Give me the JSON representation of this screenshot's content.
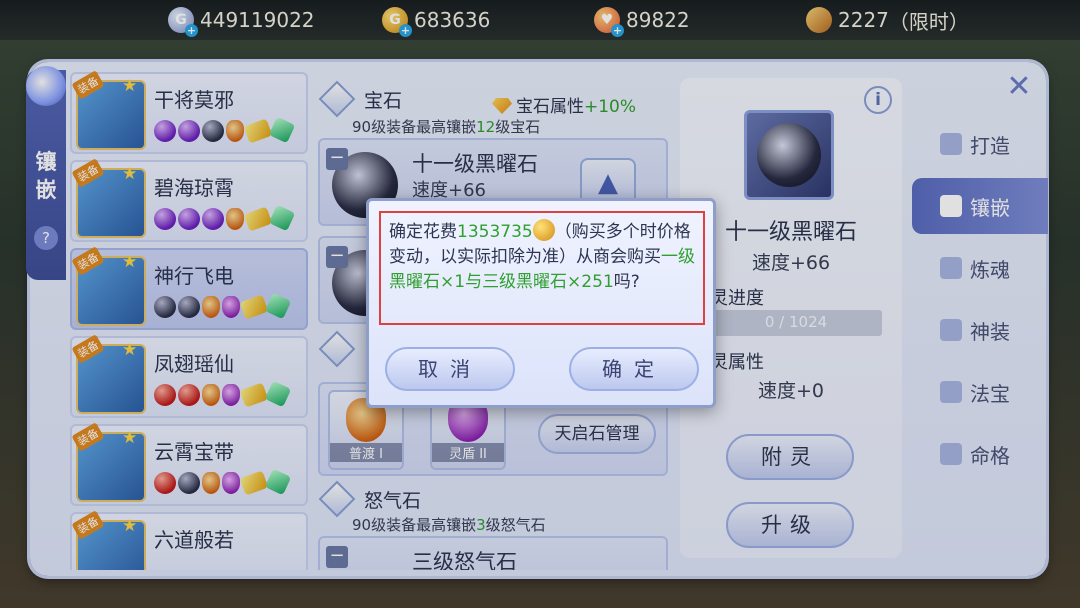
{
  "currency": {
    "silver": "449119022",
    "gold": "683636",
    "heart": "89822",
    "ticket": "2227",
    "ticket_suffix": "（限时）"
  },
  "side_tab": {
    "label_1": "镶",
    "label_2": "嵌",
    "help": "?"
  },
  "equipment": [
    {
      "badge": "装备",
      "name": "干将莫邪"
    },
    {
      "badge": "装备",
      "name": "碧海琼霄"
    },
    {
      "badge": "装备",
      "name": "神行飞电"
    },
    {
      "badge": "装备",
      "name": "凤翅瑶仙"
    },
    {
      "badge": "装备",
      "name": "云霄宝带"
    },
    {
      "badge": "装备",
      "name": "六道般若"
    }
  ],
  "gem_section": {
    "title": "宝石",
    "attr_label": "宝石属性",
    "attr_bonus": "+10%",
    "limit_prefix": "90级装备最高镶嵌",
    "limit_level": "12",
    "limit_suffix": "级宝石",
    "slot1_name": "十一级黑曜石",
    "slot1_attr": "速度+66"
  },
  "special_section": {
    "item1": "普渡 I",
    "item2": "灵盾 II",
    "manage_button": "天启石管理"
  },
  "rage_section": {
    "title": "怒气石",
    "limit_prefix": "90级装备最高镶嵌",
    "limit_level": "3",
    "limit_suffix": "级怒气石",
    "slot_name": "三级怒气石"
  },
  "detail": {
    "info": "i",
    "gem_name": "十一级黑曜石",
    "gem_attr": "速度+66",
    "progress_label": "灵进度",
    "progress_text": "0 / 1024",
    "progress_fraction": 0,
    "spirit_attr_label": "灵属性",
    "spirit_attr": "速度+0",
    "attach_button": "附灵",
    "upgrade_button": "升级"
  },
  "nav": [
    "打造",
    "镶嵌",
    "炼魂",
    "神装",
    "法宝",
    "命格"
  ],
  "dialog": {
    "line_a": "确定花费",
    "cost": "1353735",
    "line_b": "（购买多个时价格变动，以实际扣除为准）从商会购买",
    "item_a": "一级黑曜石×1",
    "and": "与",
    "item_b": "三级黑曜石×251",
    "end": "吗?",
    "cancel": "取消",
    "confirm": "确定"
  }
}
